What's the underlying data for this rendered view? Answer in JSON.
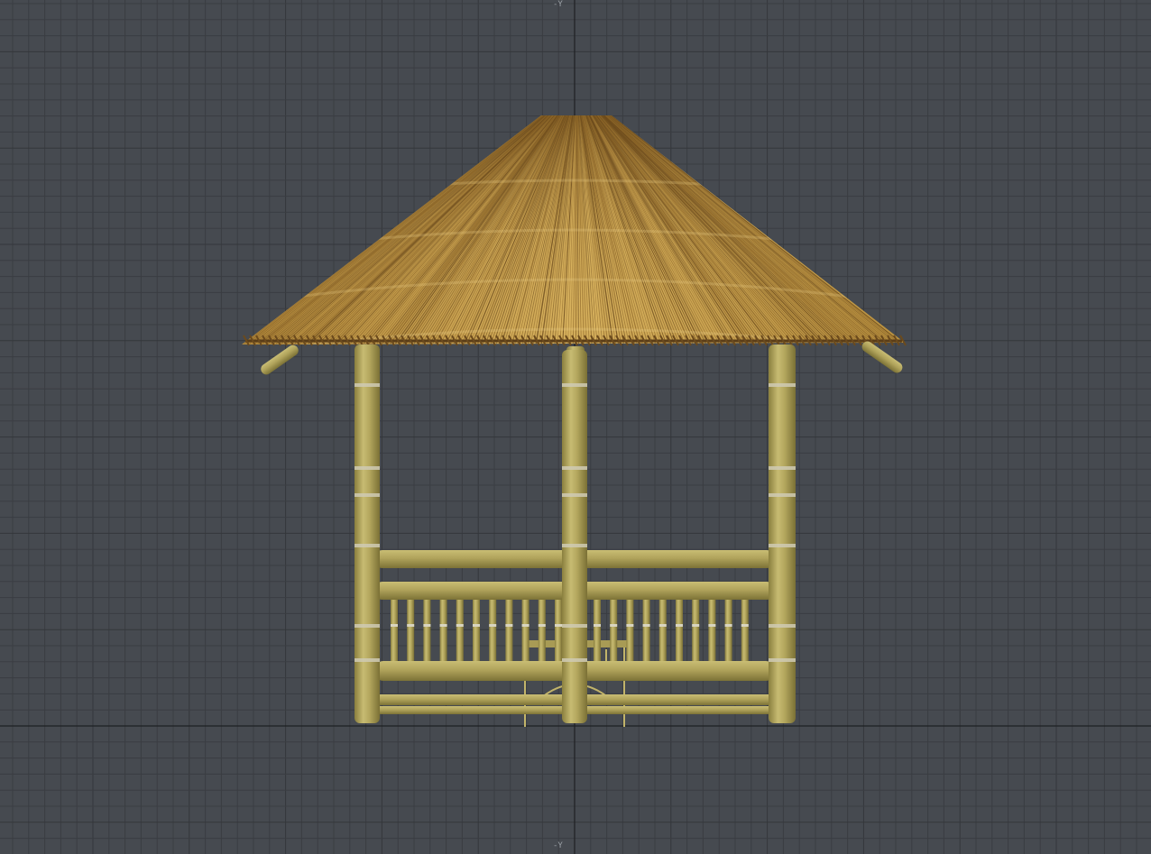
{
  "viewport": {
    "axis_label_top": "-Y",
    "axis_label_bottom": "-Y"
  },
  "colors": {
    "background": "#464a50",
    "grid_minor": "#3a3d42",
    "grid_major": "#1e2023",
    "bamboo": "#b5a962",
    "thatch": "#c9a14f"
  },
  "model": {
    "name": "bamboo-gazebo"
  }
}
